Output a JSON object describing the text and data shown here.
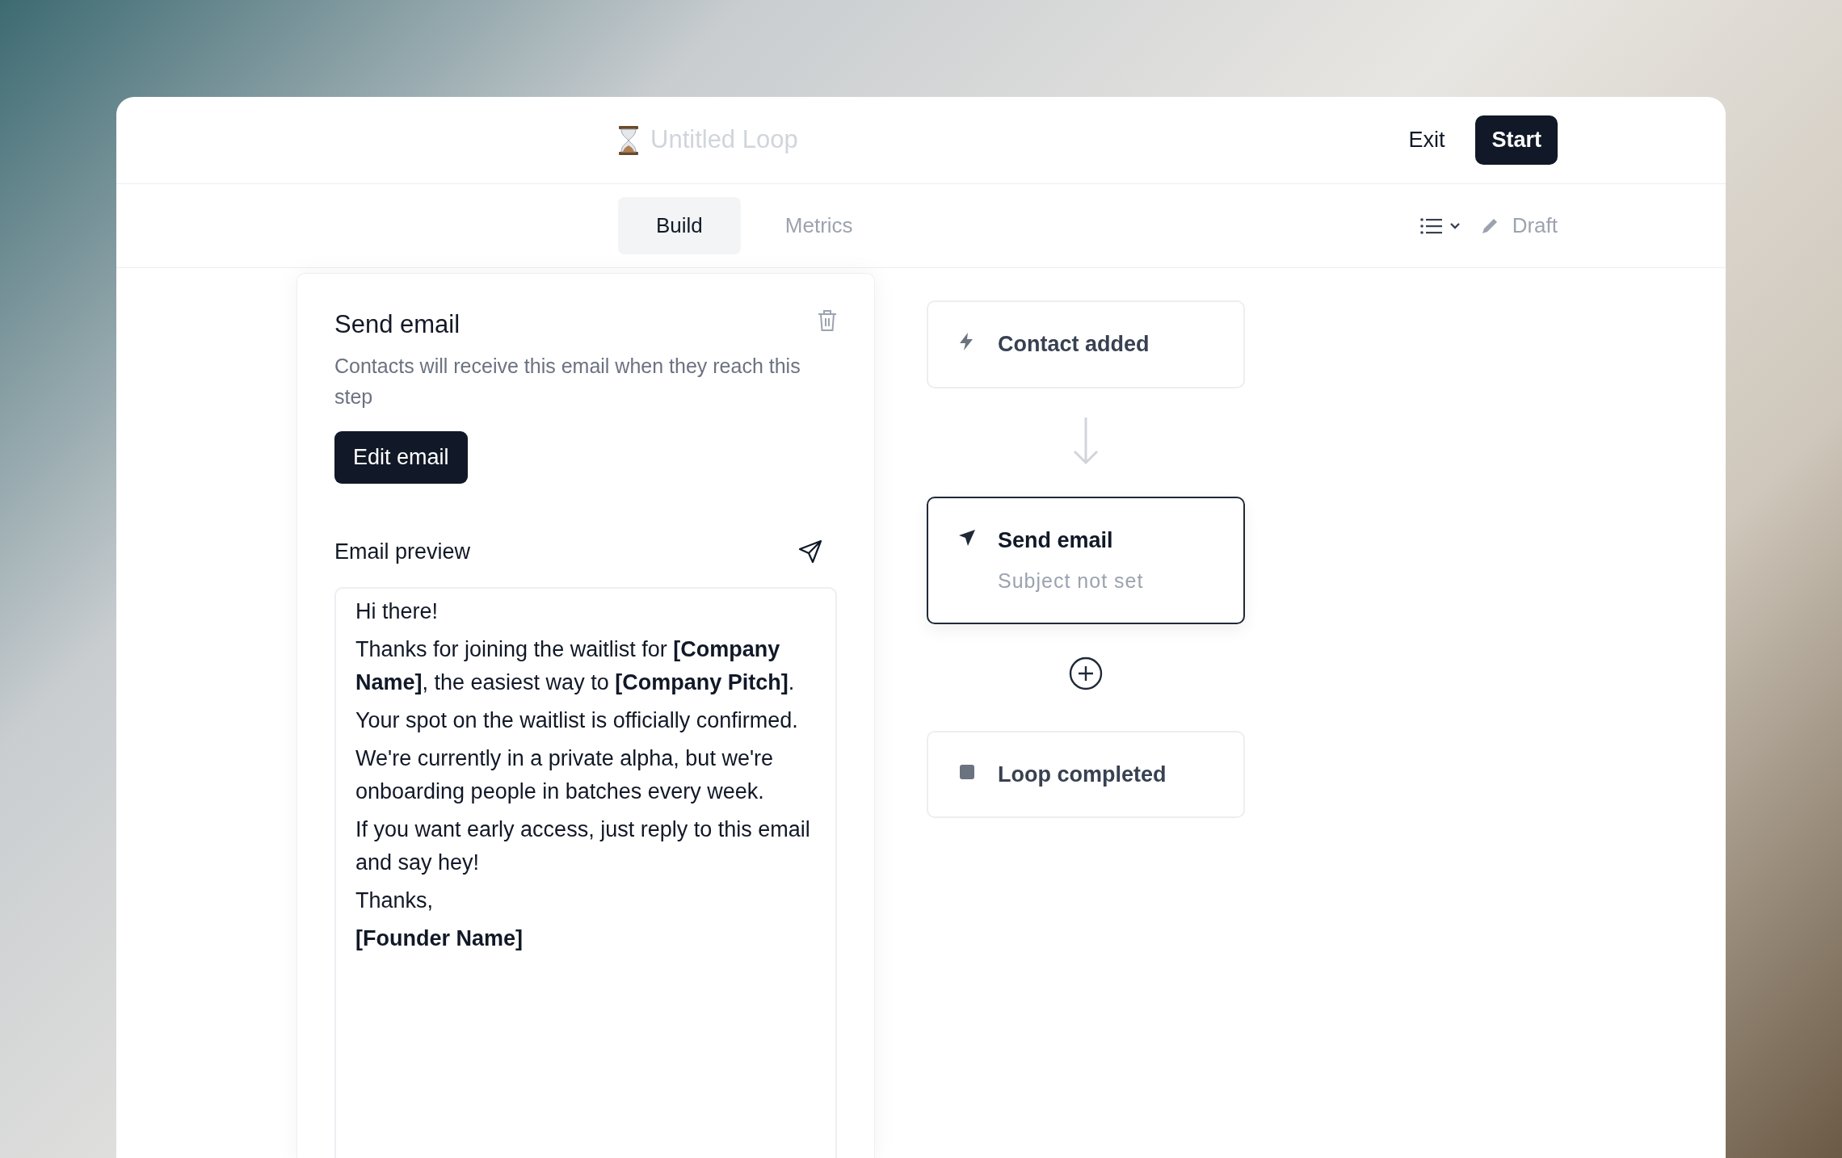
{
  "header": {
    "title": {
      "placeholder": "Untitled Loop"
    },
    "buttons": [
      {
        "label": "Exit",
        "kind": "ghost"
      },
      {
        "label": "Start",
        "kind": "primary"
      }
    ]
  },
  "tabs": [
    {
      "label": "Build",
      "selected": true
    },
    {
      "label": "Metrics",
      "selected": false
    }
  ],
  "toolbar": {
    "status": "Draft"
  },
  "step_panel": {
    "title": "Send email",
    "description": "Contacts will receive this email when they reach this step",
    "button": "Edit email",
    "preview": {
      "label": "Email preview",
      "paragraphs": [
        {
          "kind": "text",
          "text": "Hi there!"
        },
        {
          "kind": "text",
          "text": "Thanks for joining the waitlist for **[Company Name]**, the easiest way to **[Company Pitch]**."
        },
        {
          "kind": "text",
          "text": "Your spot on the waitlist is officially confirmed."
        },
        {
          "kind": "text",
          "text": "We're currently in a private alpha, but we're onboarding people in batches every week."
        },
        {
          "kind": "text",
          "text": "If you want early access, just reply to this email and say hey!"
        },
        {
          "kind": "text",
          "text": "Thanks,"
        },
        {
          "kind": "signature",
          "text": "[Founder Name]"
        }
      ]
    }
  },
  "flow": {
    "nodes": [
      {
        "kind": "trigger",
        "title": "Contact added",
        "selected": false
      },
      {
        "kind": "email",
        "title": "Send email",
        "subtitle": "Subject not set",
        "selected": true
      },
      {
        "kind": "end",
        "title": "Loop completed",
        "selected": false
      }
    ]
  }
}
